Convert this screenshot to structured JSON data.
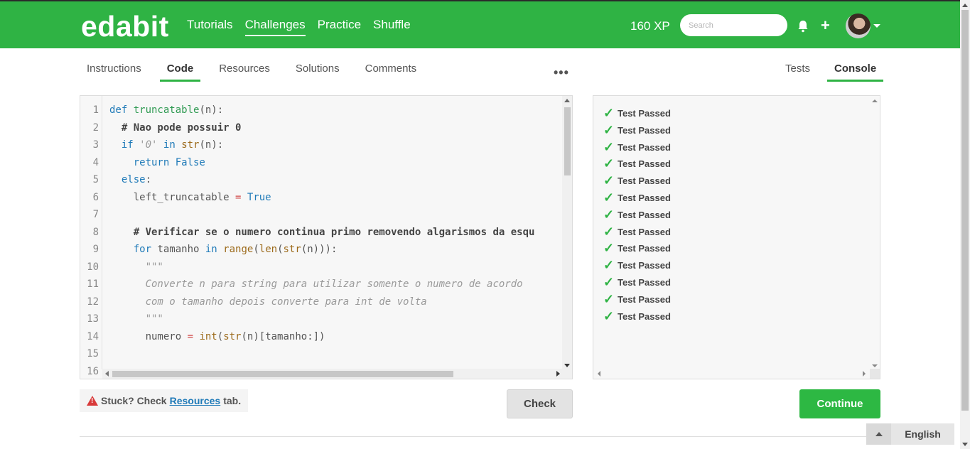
{
  "header": {
    "brand": "edabit",
    "nav": [
      {
        "label": "Tutorials",
        "active": false
      },
      {
        "label": "Challenges",
        "active": true
      },
      {
        "label": "Practice",
        "active": false
      },
      {
        "label": "Shuffle",
        "active": false
      }
    ],
    "xp": "160 XP",
    "search_placeholder": "Search",
    "icons": [
      "bell-icon",
      "plus-icon",
      "avatar",
      "chevron-down-icon"
    ]
  },
  "tabs": {
    "left": [
      {
        "label": "Instructions",
        "active": false
      },
      {
        "label": "Code",
        "active": true
      },
      {
        "label": "Resources",
        "active": false
      },
      {
        "label": "Solutions",
        "active": false
      },
      {
        "label": "Comments",
        "active": false
      }
    ],
    "more": "•••",
    "right": [
      {
        "label": "Tests",
        "active": false
      },
      {
        "label": "Console",
        "active": true
      }
    ]
  },
  "editor": {
    "line_numbers": [
      "1",
      "2",
      "3",
      "4",
      "5",
      "6",
      "7",
      "8",
      "9",
      "10",
      "11",
      "12",
      "13",
      "14",
      "15",
      "16"
    ],
    "lines": [
      [
        {
          "t": "def ",
          "c": "kw"
        },
        {
          "t": "truncatable",
          "c": "fn"
        },
        {
          "t": "(n):",
          "c": ""
        }
      ],
      [
        {
          "t": "  ",
          "c": ""
        },
        {
          "t": "# Nao pode possuir 0",
          "c": "cm"
        }
      ],
      [
        {
          "t": "  ",
          "c": ""
        },
        {
          "t": "if ",
          "c": "kw"
        },
        {
          "t": "'0'",
          "c": "str"
        },
        {
          "t": " ",
          "c": ""
        },
        {
          "t": "in ",
          "c": "kw"
        },
        {
          "t": "str",
          "c": "bi"
        },
        {
          "t": "(n):",
          "c": ""
        }
      ],
      [
        {
          "t": "    ",
          "c": ""
        },
        {
          "t": "return False",
          "c": "kw"
        }
      ],
      [
        {
          "t": "  ",
          "c": ""
        },
        {
          "t": "else",
          "c": "kw"
        },
        {
          "t": ":",
          "c": ""
        }
      ],
      [
        {
          "t": "    left_truncatable ",
          "c": ""
        },
        {
          "t": "=",
          "c": "op"
        },
        {
          "t": " ",
          "c": ""
        },
        {
          "t": "True",
          "c": "kw"
        }
      ],
      [
        {
          "t": "",
          "c": ""
        }
      ],
      [
        {
          "t": "    ",
          "c": ""
        },
        {
          "t": "# Verificar se o numero continua primo removendo algarismos da esqu",
          "c": "cm"
        }
      ],
      [
        {
          "t": "    ",
          "c": ""
        },
        {
          "t": "for ",
          "c": "kw"
        },
        {
          "t": "tamanho ",
          "c": ""
        },
        {
          "t": "in ",
          "c": "kw"
        },
        {
          "t": "range",
          "c": "bi"
        },
        {
          "t": "(",
          "c": ""
        },
        {
          "t": "len",
          "c": "bi"
        },
        {
          "t": "(",
          "c": ""
        },
        {
          "t": "str",
          "c": "bi"
        },
        {
          "t": "(n))):",
          "c": ""
        }
      ],
      [
        {
          "t": "      ",
          "c": ""
        },
        {
          "t": "\"\"\"",
          "c": "str"
        }
      ],
      [
        {
          "t": "      ",
          "c": ""
        },
        {
          "t": "Converte n para string para utilizar somente o numero de acordo",
          "c": "str"
        }
      ],
      [
        {
          "t": "      ",
          "c": ""
        },
        {
          "t": "com o tamanho depois converte para int de volta",
          "c": "str"
        }
      ],
      [
        {
          "t": "      ",
          "c": ""
        },
        {
          "t": "\"\"\"",
          "c": "str"
        }
      ],
      [
        {
          "t": "      numero ",
          "c": ""
        },
        {
          "t": "=",
          "c": "op"
        },
        {
          "t": " ",
          "c": ""
        },
        {
          "t": "int",
          "c": "bi"
        },
        {
          "t": "(",
          "c": ""
        },
        {
          "t": "str",
          "c": "bi"
        },
        {
          "t": "(n)[tamanho:])",
          "c": ""
        }
      ],
      [
        {
          "t": "",
          "c": ""
        }
      ],
      [
        {
          "t": "",
          "c": ""
        }
      ]
    ]
  },
  "console": {
    "results": [
      "Test Passed",
      "Test Passed",
      "Test Passed",
      "Test Passed",
      "Test Passed",
      "Test Passed",
      "Test Passed",
      "Test Passed",
      "Test Passed",
      "Test Passed",
      "Test Passed",
      "Test Passed",
      "Test Passed"
    ],
    "check_glyph": "✓"
  },
  "footer": {
    "hint_prefix": "Stuck? Check",
    "hint_link": "Resources",
    "hint_suffix": "tab.",
    "check_label": "Check",
    "continue_label": "Continue",
    "language": "English"
  },
  "colors": {
    "brand_green": "#2fb344",
    "link_blue": "#1f7ab8",
    "warn_red": "#d83a3a"
  }
}
